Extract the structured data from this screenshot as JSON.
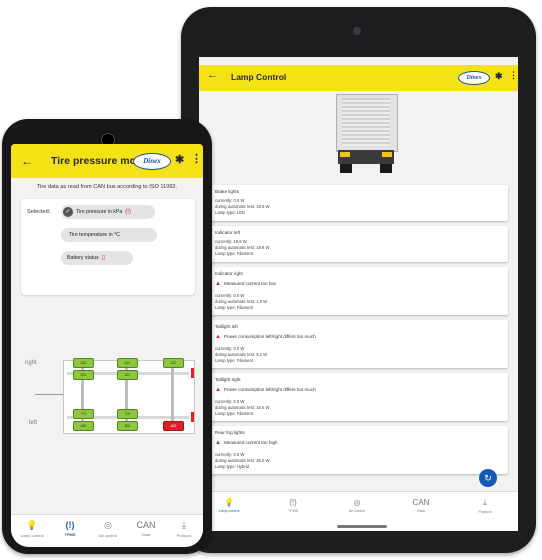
{
  "tablet": {
    "appbar": {
      "back": "←",
      "title": "Lamp Control",
      "logo_text": "Dinex",
      "bluetooth": "✱",
      "more": "⋮"
    },
    "lamps": [
      {
        "title": "Brake lights",
        "warning": "",
        "lines": [
          "currently: 0.0 W",
          "during automatic test: 19.9 W",
          "Lamp type: LED"
        ],
        "selected": false
      },
      {
        "title": "Indicator left",
        "warning": "",
        "lines": [
          "currently: 19.9 W",
          "during automatic test: 19.8 W",
          "Lamp type: Filament"
        ],
        "selected": true
      },
      {
        "title": "Indicator right",
        "warning": "Measured current too low",
        "lines": [
          "currently: 0.0 W",
          "during automatic test: 1.0 W",
          "Lamp type: Filament"
        ],
        "selected": false
      },
      {
        "title": "Taillight left",
        "warning": "Power consumption left/right differs too much",
        "lines": [
          "currently: 0.0 W",
          "during automatic test: 9.1 W",
          "Lamp type: Filament"
        ],
        "selected": false
      },
      {
        "title": "Taillight right",
        "warning": "Power consumption left/right differs too much",
        "lines": [
          "currently: 0.0 W",
          "during automatic test: 16.6 W",
          "Lamp type: Filament"
        ],
        "selected": false
      },
      {
        "title": "Rear fog lights",
        "warning": "Measured current too high",
        "lines": [
          "currently: 0.0 W",
          "during automatic test: 35.0 W",
          "Lamp type: Hybrid"
        ],
        "selected": false
      }
    ],
    "fab_icon": "↻",
    "nav": [
      {
        "icon": "💡",
        "label": "Lamp control",
        "active": true
      },
      {
        "icon": "(!)",
        "label": "TPMS",
        "active": false
      },
      {
        "icon": "◎",
        "label": "Air control",
        "active": false
      },
      {
        "icon": "CAN",
        "label": "Data",
        "active": false
      },
      {
        "icon": "⤓",
        "label": "Protocol",
        "active": false
      }
    ]
  },
  "phone": {
    "appbar": {
      "back": "←",
      "title": "Tire pressure mo...",
      "logo_text": "Dinex",
      "bluetooth": "✱",
      "more": "⋮"
    },
    "description": "Tire data as read from CAN bus according to ISO 11992.",
    "selected_label": "Selected:",
    "chips": [
      {
        "label": "Tire pressure in kPa",
        "checked": true,
        "icon": "(!)"
      },
      {
        "label": "Tire temperature in °C",
        "checked": false,
        "icon": ""
      },
      {
        "label": "Battery status",
        "checked": false,
        "icon": "▯"
      }
    ],
    "axle_labels": {
      "right": "right",
      "left": "left"
    },
    "tire_values": {
      "axle1_right_outer": "820",
      "axle1_right_inner": "820",
      "axle1_left_inner": "770",
      "axle1_left_outer": "680",
      "axle2_right_outer": "820",
      "axle2_right_inner": "820",
      "axle2_left_inner": "700",
      "axle2_left_outer": "800",
      "axle3_right_outer": "820",
      "axle3_left_outer": "400"
    },
    "nav": [
      {
        "icon": "💡",
        "label": "Lamp control",
        "active": false
      },
      {
        "icon": "(!)",
        "label": "TPMS",
        "active": true
      },
      {
        "icon": "◎",
        "label": "Air control",
        "active": false
      },
      {
        "icon": "CAN",
        "label": "Data",
        "active": false
      },
      {
        "icon": "⤓",
        "label": "Protocol",
        "active": false
      }
    ]
  },
  "colors": {
    "accent_yellow": "#f5e216",
    "active_blue": "#1f5db8",
    "warning_red": "#e31f26",
    "tire_ok_green": "#8ec640"
  }
}
